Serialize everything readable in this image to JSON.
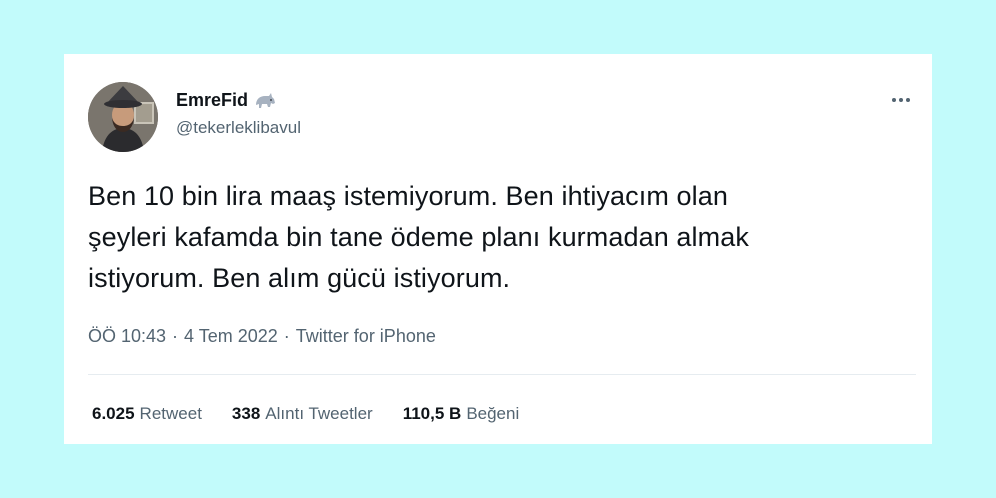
{
  "user": {
    "display_name": "EmreFid",
    "badge_icon": "rhino-emoji-icon",
    "handle": "@tekerleklibavul"
  },
  "more_icon": "more-horizontal-icon",
  "tweet": {
    "lines": [
      "Ben 10 bin lira maaş istemiyorum. Ben ihtiyacım olan",
      "şeyleri kafamda bin tane ödeme planı kurmadan almak",
      "istiyorum. Ben alım gücü istiyorum."
    ],
    "time": "ÖÖ 10:43",
    "date": "4 Tem 2022",
    "separator": "·",
    "source": "Twitter for iPhone"
  },
  "stats": {
    "retweets": {
      "count": "6.025",
      "label": "Retweet"
    },
    "quotes": {
      "count": "338",
      "label": "Alıntı Tweetler"
    },
    "likes": {
      "count": "110,5 B",
      "label": "Beğeni"
    }
  },
  "colors": {
    "page_background": "#c2fbfb",
    "card_background": "#ffffff",
    "text_primary": "#0f1419",
    "text_secondary": "#536471"
  }
}
